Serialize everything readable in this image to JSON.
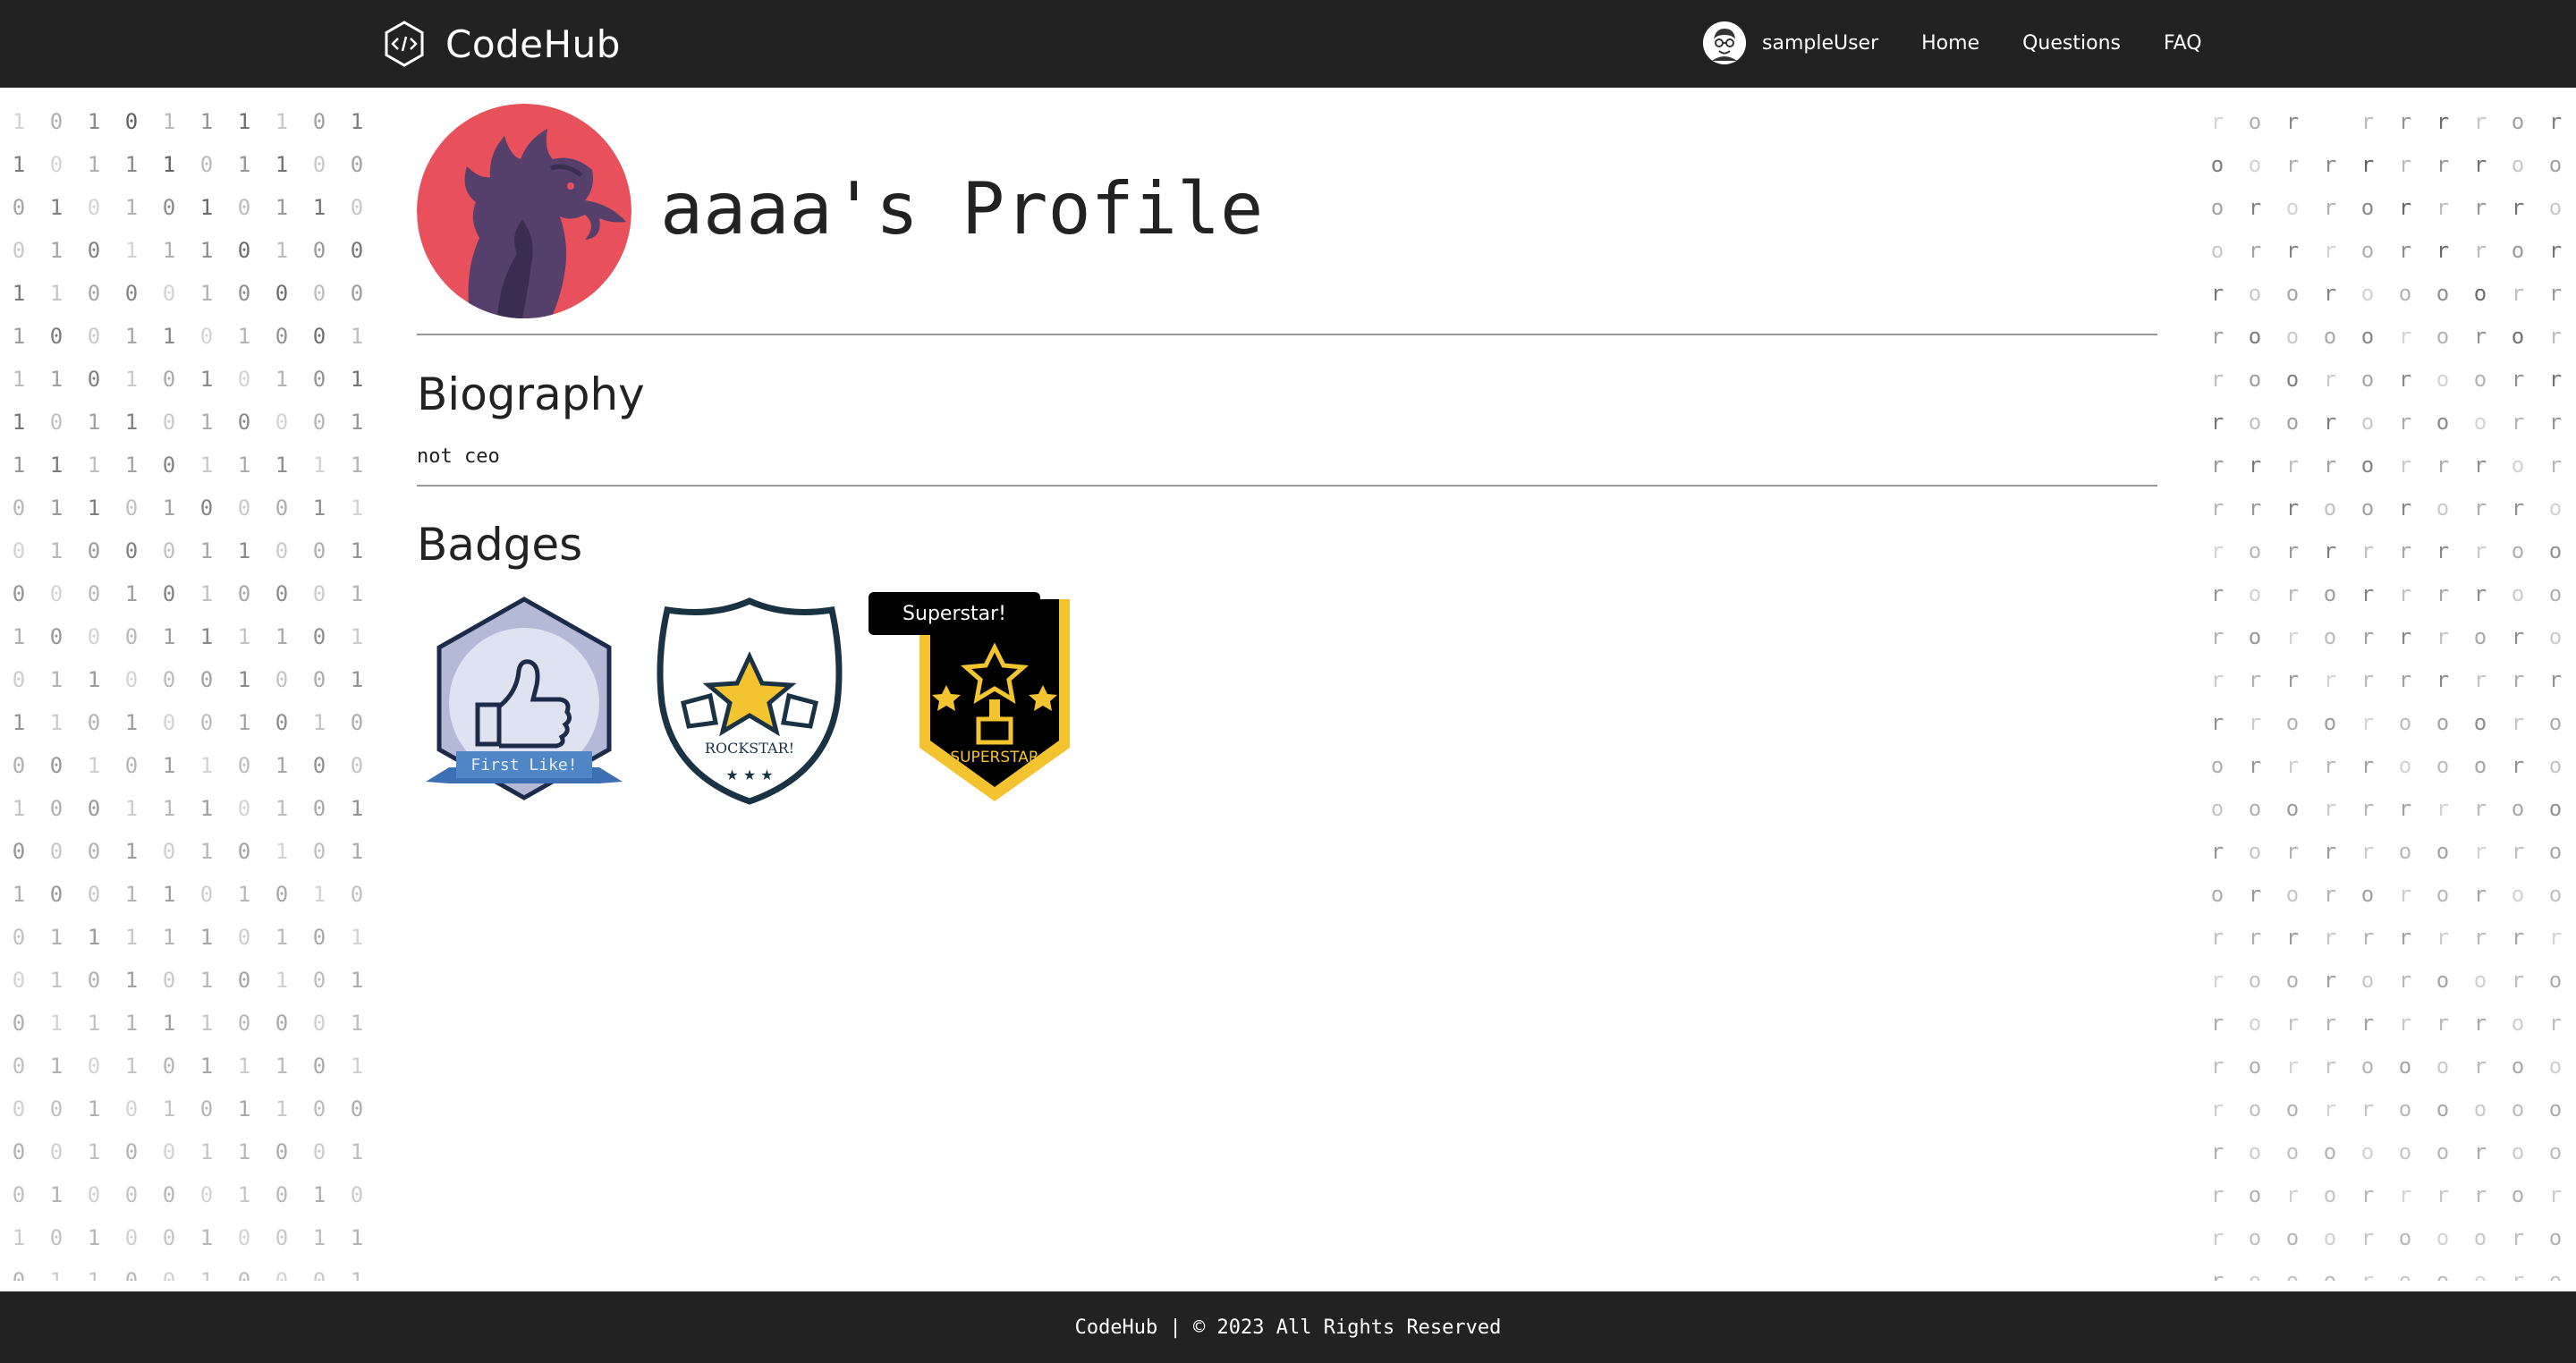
{
  "navbar": {
    "brand": "CodeHub",
    "user": "sampleUser",
    "links": [
      "Home",
      "Questions",
      "FAQ"
    ]
  },
  "profile": {
    "title": "aaaa's Profile"
  },
  "biography": {
    "heading": "Biography",
    "text": "not ceo"
  },
  "badges": {
    "heading": "Badges",
    "items": [
      {
        "label": "First Like!"
      },
      {
        "label": "ROCKSTAR!"
      },
      {
        "label": "SUPERSTAR",
        "tooltip": "Superstar!"
      }
    ]
  },
  "footer": {
    "text": "CodeHub | © 2023 All Rights Reserved"
  },
  "background_pattern": {
    "left": [
      "1010111101",
      "1011101100",
      "0101010110",
      "0101110100",
      "1100010000",
      "1001101001",
      "1101010101",
      "1011010001",
      "1111011111",
      "0110100011",
      "0100011001",
      "0001010001",
      "1000111101",
      "0110001001",
      "1101001010",
      "0010110100",
      "1001110101",
      "0001010101",
      "1001101010",
      "0111110101",
      "0101010101",
      "0111110001",
      "0101011101",
      "0010101100",
      "0010011001",
      "0100001010",
      "1010010011",
      "0110010001"
    ],
    "right": [
      "ror rrrror",
      "oorrrrrroo",
      "orororrrro",
      "orrrorrror",
      "rooroooorr",
      "roooororor",
      "roororoorr",
      "roororoorr",
      "rrrrorrror",
      "rrroororro",
      "rorrrrrroo",
      "rororrrroo",
      "rororrroro",
      "rrrrrrrrrr",
      "rrooroooro",
      "orrrroooro",
      "ooorrrrroo",
      "rorrroorro",
      "ororororoo",
      "rrrrrrrrrr",
      "roororooro",
      "rorrrrrror",
      "rorroooroo",
      "roorrooooo",
      "rooooooroo",
      "rororrrror",
      "roooroooro",
      "roooroooro"
    ],
    "digit_color": "#555555"
  },
  "colors": {
    "navbar_bg": "#222222",
    "avatar_bg": "#e8505b",
    "rule": "#999999",
    "badge_gold": "#f4c430",
    "badge_navy": "#1a3344"
  }
}
